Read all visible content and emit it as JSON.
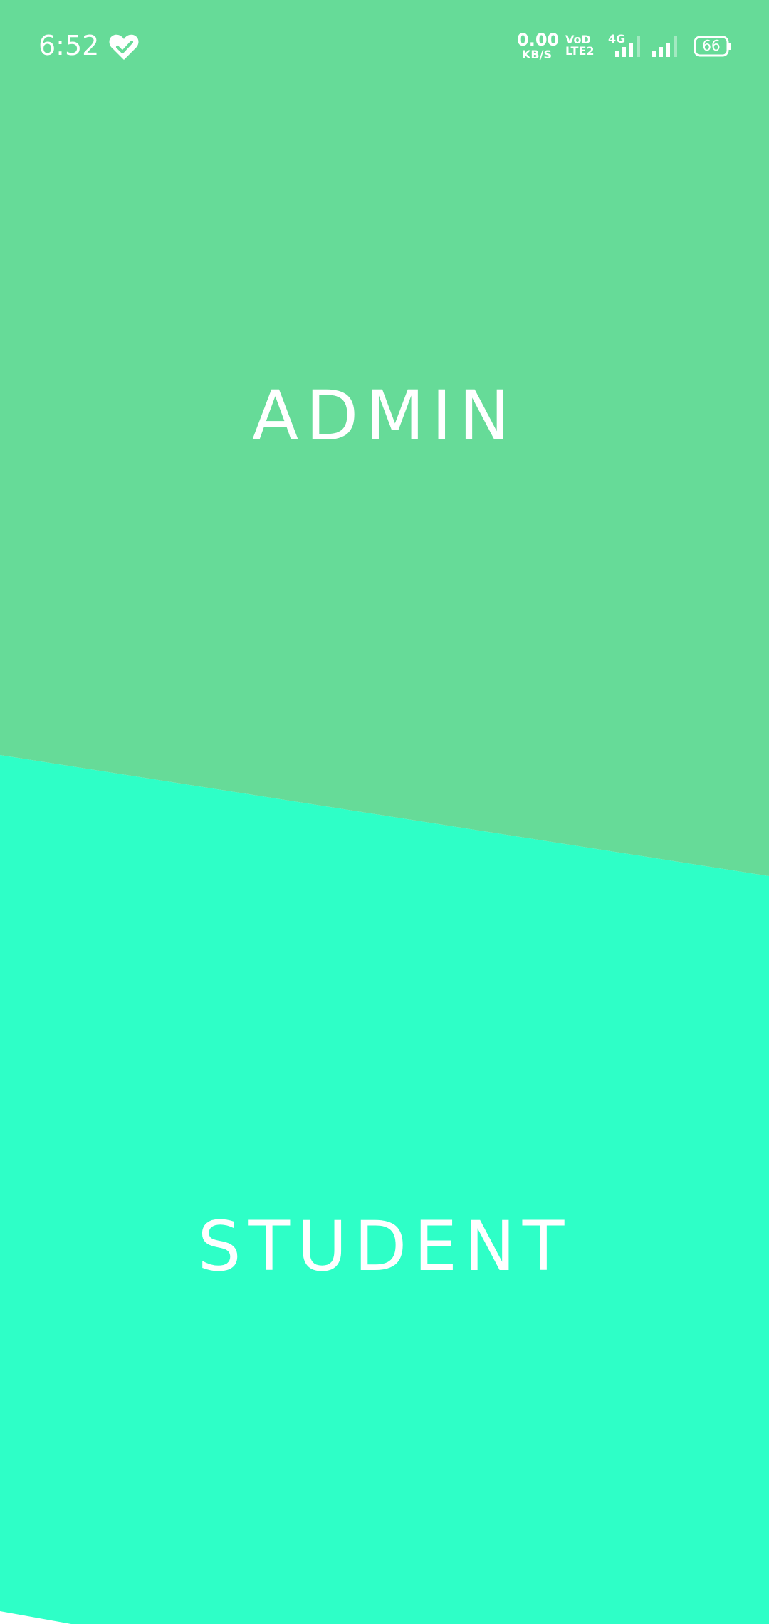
{
  "status_bar": {
    "time": "6:52",
    "net_speed_value": "0.00",
    "net_speed_unit": "KB/S",
    "volte_top": "VoD",
    "volte_bottom": "LTE2",
    "network_type": "4G",
    "battery_level": "66",
    "icons": [
      "heart-check-icon",
      "signal-icon",
      "battery-icon"
    ]
  },
  "roles": {
    "admin_label": "ADMIN",
    "student_label": "STUDENT"
  },
  "colors": {
    "admin_panel": "#66DB98",
    "student_panel": "#2EFFC7",
    "text": "#FFFFFF"
  }
}
